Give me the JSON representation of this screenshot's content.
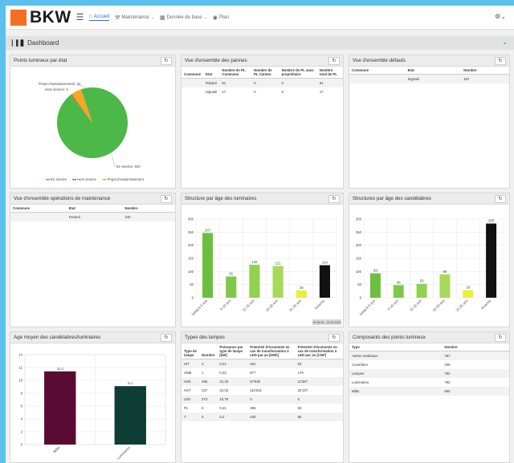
{
  "app": {
    "logo": "BKW"
  },
  "nav": [
    {
      "label": "Accueil",
      "icon": "home-icon",
      "active": true
    },
    {
      "label": "Maintenance",
      "icon": "wrench-icon",
      "dropdown": true
    },
    {
      "label": "Donnée de base",
      "icon": "database-icon",
      "dropdown": true
    },
    {
      "label": "Plan",
      "icon": "map-pin-icon"
    }
  ],
  "dashboard": {
    "title": "Dashboard"
  },
  "panels": {
    "p1": {
      "title": "Points lumineux par état"
    },
    "p2": {
      "title": "Vue d'ensemble des pannes"
    },
    "p3": {
      "title": "Vue d'ensemble défauts"
    },
    "p4": {
      "title": "Vue d'ensemble opérations de maintenance"
    },
    "p5": {
      "title": "Structure par âge des luminaires"
    },
    "p6": {
      "title": "Structures par âge des candélabres"
    },
    "p7": {
      "title": "Age moyen des candélabres/luminaires"
    },
    "p8": {
      "title": "Types des lampes"
    },
    "p9": {
      "title": "Composants des points lumineux"
    }
  },
  "pannes": {
    "headers": [
      "Commune",
      "Etat",
      "Nombre de PL Commune",
      "Nombre de PL Canton",
      "Nombre de PL sans propriétaire",
      "Nombre total de PL"
    ],
    "rows": [
      [
        "",
        "Réparé",
        "51",
        "0",
        "0",
        "51"
      ],
      [
        "",
        "Signalé",
        "17",
        "0",
        "0",
        "17"
      ]
    ]
  },
  "defauts": {
    "headers": [
      "Commune",
      "Etat",
      "Nombre"
    ],
    "rows": [
      [
        "",
        "Signalé",
        "167"
      ]
    ]
  },
  "maintenance": {
    "headers": [
      "Commune",
      "Etat",
      "Nombre"
    ],
    "rows": [
      [
        "",
        "Facturé",
        "240"
      ]
    ]
  },
  "lampes": {
    "headers": [
      "Type de lampe",
      "Nombre",
      "Puissance par type de lampe [kW]",
      "Potentiel d'économie en cas de transformation à LED par an [kWh]",
      "Potentiel d'économie en cas de transformation à LED par an [CHF]"
    ],
    "rows": [
      [
        "HIT",
        "3",
        "0,21",
        "461",
        "93"
      ],
      [
        "HME",
        "1",
        "0,23",
        "877",
        "176"
      ],
      [
        "HSE",
        "265",
        "22,33",
        "57'935",
        "11'587"
      ],
      [
        "HST",
        "237",
        "42,03",
        "110'531",
        "22'107"
      ],
      [
        "LED",
        "273",
        "10,78",
        "0",
        "0"
      ],
      [
        "PL",
        "6",
        "0,21",
        "456",
        "92"
      ],
      [
        "T",
        "5",
        "0,2",
        "430",
        "86"
      ]
    ]
  },
  "composants": {
    "headers": [
      "Type",
      "Nombre"
    ],
    "rows": [
      [
        "Autres matériaux",
        "787"
      ],
      [
        "Contrôleur",
        "208"
      ],
      [
        "Lampes",
        "792"
      ],
      [
        "Luminaires",
        "792"
      ],
      [
        "Mâts",
        "660"
      ]
    ]
  },
  "chart_data": [
    {
      "type": "pie",
      "labels": [
        "En service",
        "Hors service",
        "Projet d'assainissement"
      ],
      "values": [
        620,
        3,
        31
      ],
      "slice_labels": [
        "En service: 620",
        "Hors service: 3",
        "Projet d'assainissement: 31"
      ],
      "colors": [
        "#4cb848",
        "#e05050",
        "#f5a623"
      ],
      "legend_position": "bottom"
    },
    {
      "type": "bar",
      "categories": [
        "Jusqu'à 5 ans",
        "6-10 ans",
        "11-15 ans",
        "16-20 ans",
        "21-25 ans",
        "Inconnu"
      ],
      "values": [
        247,
        81,
        126,
        121,
        28,
        124
      ],
      "colors": [
        "#6cbf3e",
        "#7ec94a",
        "#92d050",
        "#a8d95c",
        "#e8f03a",
        "#111111"
      ],
      "ylim": [
        0,
        300
      ],
      "yticks": [
        0,
        50,
        100,
        150,
        200,
        250,
        300
      ],
      "footer": "19:18:30 - 22.09.2020"
    },
    {
      "type": "bar",
      "categories": [
        "Jusqu'à 5 ans",
        "6-10 ans",
        "11-15 ans",
        "16-20 ans",
        "21-25 ans",
        "Inconnu"
      ],
      "values": [
        93,
        48,
        53,
        89,
        29,
        283
      ],
      "colors": [
        "#6cbf3e",
        "#7ec94a",
        "#92d050",
        "#a8d95c",
        "#e8f03a",
        "#111111"
      ],
      "ylim": [
        0,
        300
      ],
      "yticks": [
        0,
        50,
        100,
        150,
        200,
        250,
        300
      ]
    },
    {
      "type": "bar",
      "categories": [
        "Mâts",
        "Luminaires"
      ],
      "values": [
        11.4,
        9.1
      ],
      "data_labels": [
        "11.4",
        "9.1"
      ],
      "colors": [
        "#5a0b33",
        "#0e3d35"
      ],
      "ylim": [
        0,
        14
      ],
      "yticks": [
        0,
        2,
        4,
        6,
        8,
        10,
        12,
        14
      ]
    }
  ]
}
